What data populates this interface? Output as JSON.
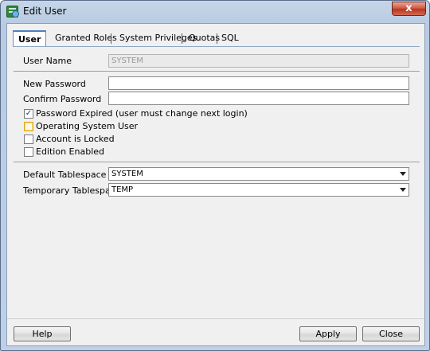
{
  "window": {
    "title": "Edit User",
    "close_symbol": "x",
    "icon": "edit-user-icon"
  },
  "tabs": [
    {
      "label": "User",
      "active": true
    },
    {
      "label": "Granted Roles",
      "active": false
    },
    {
      "label": "System Privileges",
      "active": false
    },
    {
      "label": "Quotas",
      "active": false
    },
    {
      "label": "SQL",
      "active": false
    }
  ],
  "form": {
    "user_name_label": "User Name",
    "user_name_value": "SYSTEM",
    "new_password_label": "New Password",
    "new_password_value": "",
    "confirm_password_label": "Confirm Password",
    "confirm_password_value": "",
    "checkboxes": [
      {
        "label": "Password Expired (user must change next login)",
        "checked": true
      },
      {
        "label": "Operating System User",
        "checked": false
      },
      {
        "label": "Account is Locked",
        "checked": false
      },
      {
        "label": "Edition Enabled",
        "checked": false
      }
    ],
    "default_tablespace_label": "Default Tablespace",
    "default_tablespace_value": "SYSTEM",
    "temporary_tablespace_label": "Temporary Tablespace",
    "temporary_tablespace_value": "TEMP"
  },
  "buttons": {
    "help": "Help",
    "apply": "Apply",
    "close": "Close"
  }
}
